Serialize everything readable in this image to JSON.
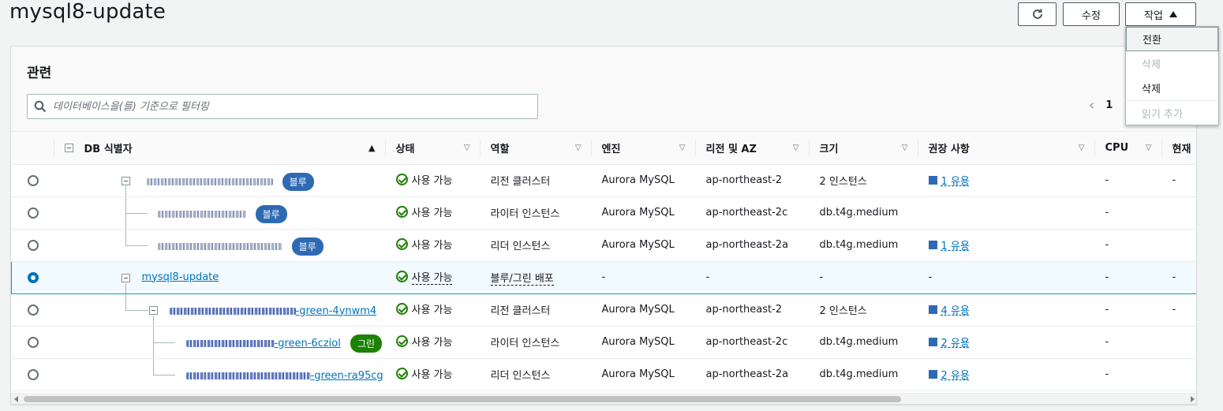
{
  "page": {
    "title": "mysql8-update"
  },
  "toolbar": {
    "refresh_icon": "refresh-icon",
    "edit_label": "수정",
    "actions_label": "작업"
  },
  "actions_menu": {
    "items": [
      {
        "label": "전환",
        "state": "hover"
      },
      {
        "label": "삭제",
        "state": "disabled"
      },
      {
        "label": "삭제",
        "state": "enabled"
      },
      {
        "label": "읽기 추가",
        "state": "disabled"
      }
    ]
  },
  "related": {
    "title": "관련",
    "search_placeholder": "데이터베이스을(를) 기준으로 필터링",
    "page_number": "1"
  },
  "table": {
    "columns": {
      "db_id": "DB 식별자",
      "status": "상태",
      "role": "역할",
      "engine": "엔진",
      "region": "리전 및 AZ",
      "size": "크기",
      "recommendation": "권장 사항",
      "cpu": "CPU",
      "current": "현재"
    },
    "rows": [
      {
        "id_suffix": "",
        "badge": "블루",
        "status": "사용 가능",
        "role": "리전 클러스터",
        "engine": "Aurora MySQL",
        "region": "ap-northeast-2",
        "size": "2 인스턴스",
        "rec": "1 유용",
        "cpu": "-",
        "current": "-"
      },
      {
        "id_suffix": "",
        "badge": "블루",
        "status": "사용 가능",
        "role": "라이터 인스턴스",
        "engine": "Aurora MySQL",
        "region": "ap-northeast-2c",
        "size": "db.t4g.medium",
        "rec": "",
        "cpu": "-",
        "current": ""
      },
      {
        "id_suffix": "",
        "badge": "블루",
        "status": "사용 가능",
        "role": "리더 인스턴스",
        "engine": "Aurora MySQL",
        "region": "ap-northeast-2a",
        "size": "db.t4g.medium",
        "rec": "1 유용",
        "cpu": "-",
        "current": ""
      },
      {
        "id_suffix": "mysql8-update",
        "badge": "",
        "status": "사용 가능",
        "role": "블루/그린 배포",
        "engine": "-",
        "region": "-",
        "size": "-",
        "rec": "-",
        "cpu": "-",
        "current": "-"
      },
      {
        "id_suffix": "-green-4ynwm4",
        "badge": "그린",
        "status": "사용 가능",
        "role": "리전 클러스터",
        "engine": "Aurora MySQL",
        "region": "ap-northeast-2",
        "size": "2 인스턴스",
        "rec": "4 유용",
        "cpu": "-",
        "current": "-"
      },
      {
        "id_suffix": "-green-6cziol",
        "badge": "그린",
        "status": "사용 가능",
        "role": "라이터 인스턴스",
        "engine": "Aurora MySQL",
        "region": "ap-northeast-2c",
        "size": "db.t4g.medium",
        "rec": "2 유용",
        "cpu": "-",
        "current": ""
      },
      {
        "id_suffix": "-green-ra95cg",
        "badge": "그린",
        "status": "사용 가능",
        "role": "리더 인스턴스",
        "engine": "Aurora MySQL",
        "region": "ap-northeast-2a",
        "size": "db.t4g.medium",
        "rec": "2 유용",
        "cpu": "-",
        "current": ""
      }
    ]
  },
  "colors": {
    "accent": "#0073bb",
    "badge_blue": "#2e6ab4",
    "badge_green": "#1d8102",
    "status_ok": "#1d8102"
  }
}
